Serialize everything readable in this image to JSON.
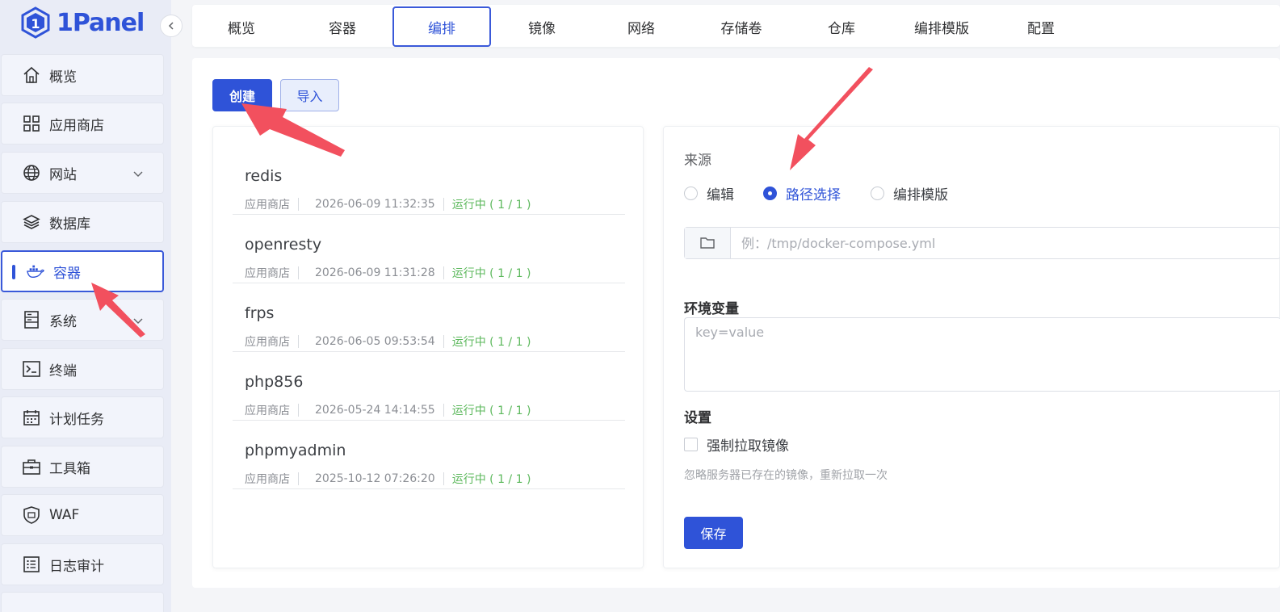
{
  "app": {
    "logo_text": "1Panel"
  },
  "sidebar": {
    "items": [
      {
        "label": "概览",
        "icon": "home-icon"
      },
      {
        "label": "应用商店",
        "icon": "grid-icon"
      },
      {
        "label": "网站",
        "icon": "globe-icon",
        "has_arrow": true
      },
      {
        "label": "数据库",
        "icon": "layers-icon"
      },
      {
        "label": "容器",
        "icon": "docker-icon",
        "active": true
      },
      {
        "label": "系统",
        "icon": "server-icon",
        "has_arrow": true
      },
      {
        "label": "终端",
        "icon": "terminal-icon"
      },
      {
        "label": "计划任务",
        "icon": "calendar-icon"
      },
      {
        "label": "工具箱",
        "icon": "toolbox-icon"
      },
      {
        "label": "WAF",
        "icon": "shield-icon"
      },
      {
        "label": "日志审计",
        "icon": "log-icon"
      }
    ]
  },
  "tabs": [
    {
      "label": "概览"
    },
    {
      "label": "容器"
    },
    {
      "label": "编排",
      "active": true
    },
    {
      "label": "镜像"
    },
    {
      "label": "网络"
    },
    {
      "label": "存储卷"
    },
    {
      "label": "仓库"
    },
    {
      "label": "编排模版"
    },
    {
      "label": "配置"
    }
  ],
  "toolbar": {
    "create_label": "创建",
    "import_label": "导入"
  },
  "compose_list": [
    {
      "name": "redis",
      "source": "应用商店",
      "date": "2026-06-09 11:32:35",
      "status": "运行中 ( 1 / 1 )"
    },
    {
      "name": "openresty",
      "source": "应用商店",
      "date": "2026-06-09 11:31:28",
      "status": "运行中 ( 1 / 1 )"
    },
    {
      "name": "frps",
      "source": "应用商店",
      "date": "2026-06-05 09:53:54",
      "status": "运行中 ( 1 / 1 )"
    },
    {
      "name": "php856",
      "source": "应用商店",
      "date": "2026-05-24 14:14:55",
      "status": "运行中 ( 1 / 1 )"
    },
    {
      "name": "phpmyadmin",
      "source": "应用商店",
      "date": "2025-10-12 07:26:20",
      "status": "运行中 ( 1 / 1 )"
    }
  ],
  "form": {
    "source_label": "来源",
    "source_options": [
      {
        "label": "编辑",
        "selected": false
      },
      {
        "label": "路径选择",
        "selected": true
      },
      {
        "label": "编排模版",
        "selected": false
      }
    ],
    "path_placeholder": "例：/tmp/docker-compose.yml",
    "env_label": "环境变量",
    "env_placeholder": "key=value",
    "settings_label": "设置",
    "force_pull_label": "强制拉取镜像",
    "force_pull_checked": false,
    "force_pull_hint": "忽略服务器已存在的镜像，重新拉取一次",
    "save_label": "保存"
  },
  "colors": {
    "accent": "#2f53d8",
    "status_running": "#5cb85c",
    "annotation_arrow": "#f2505e"
  }
}
